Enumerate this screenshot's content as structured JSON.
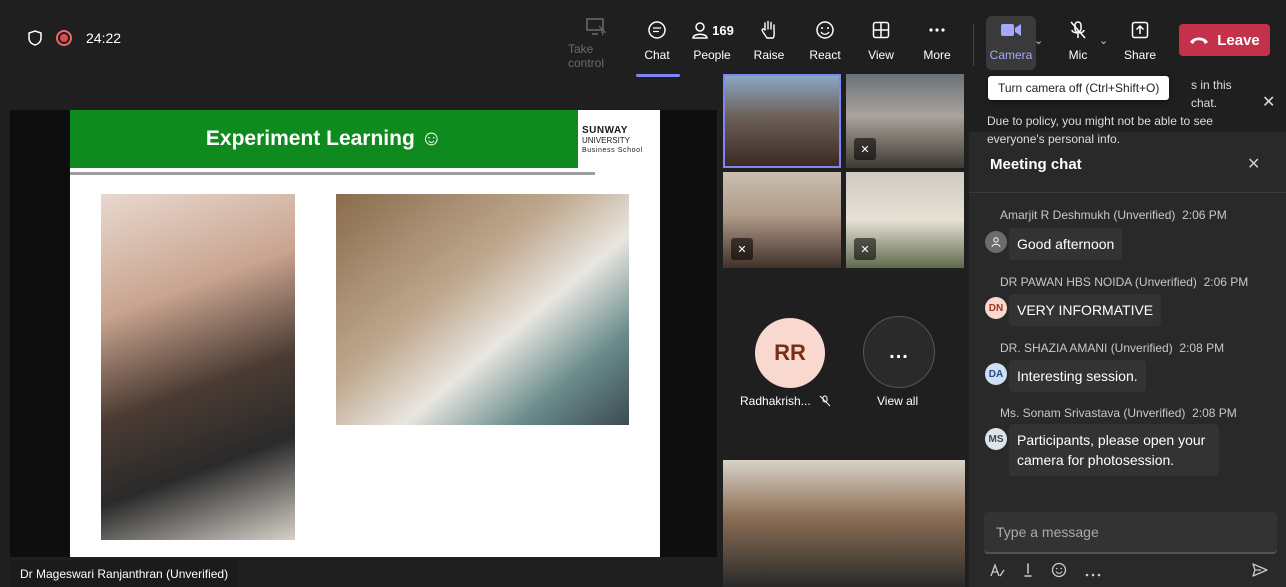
{
  "status": {
    "timer": "24:22"
  },
  "toolbar": {
    "take_control": "Take control",
    "chat": "Chat",
    "people": "People",
    "people_count": "169",
    "raise": "Raise",
    "react": "React",
    "view": "View",
    "more": "More",
    "camera": "Camera",
    "mic": "Mic",
    "share": "Share",
    "leave": "Leave"
  },
  "tooltip": {
    "camera": "Turn camera off (Ctrl+Shift+O)"
  },
  "slide": {
    "title": "Experiment Learning ☺",
    "logo_line1": "SUNWAY",
    "logo_line2": "UNIVERSITY",
    "logo_line3": "Business School"
  },
  "presenter": {
    "name": "Dr Mageswari Ranjanthran (Unverified)"
  },
  "participants": {
    "rr_initials": "RR",
    "rr_name": "Radhakrish...",
    "view_all": "View all",
    "view_all_glyph": "..."
  },
  "chat": {
    "notice_line1": "s in this chat.",
    "notice_line2": "Due to policy, you might not be able to see",
    "notice_line3": "everyone's personal info.",
    "title": "Meeting chat",
    "messages": [
      {
        "author": "Amarjit R Deshmukh (Unverified)",
        "time": "2:06 PM",
        "initials": "",
        "text": "Good afternoon"
      },
      {
        "author": "DR PAWAN HBS NOIDA (Unverified)",
        "time": "2:06 PM",
        "initials": "DN",
        "text": "VERY INFORMATIVE"
      },
      {
        "author": "DR. SHAZIA AMANI (Unverified)",
        "time": "2:08 PM",
        "initials": "DA",
        "text": "Interesting session."
      },
      {
        "author": "Ms. Sonam Srivastava (Unverified)",
        "time": "2:08 PM",
        "initials": "MS",
        "text": "Participants, please open your camera for photosession."
      }
    ],
    "placeholder": "Type a message"
  },
  "colors": {
    "accent": "#7f85f5",
    "leave": "#c4314b",
    "slide_green": "#0e8a1e"
  }
}
